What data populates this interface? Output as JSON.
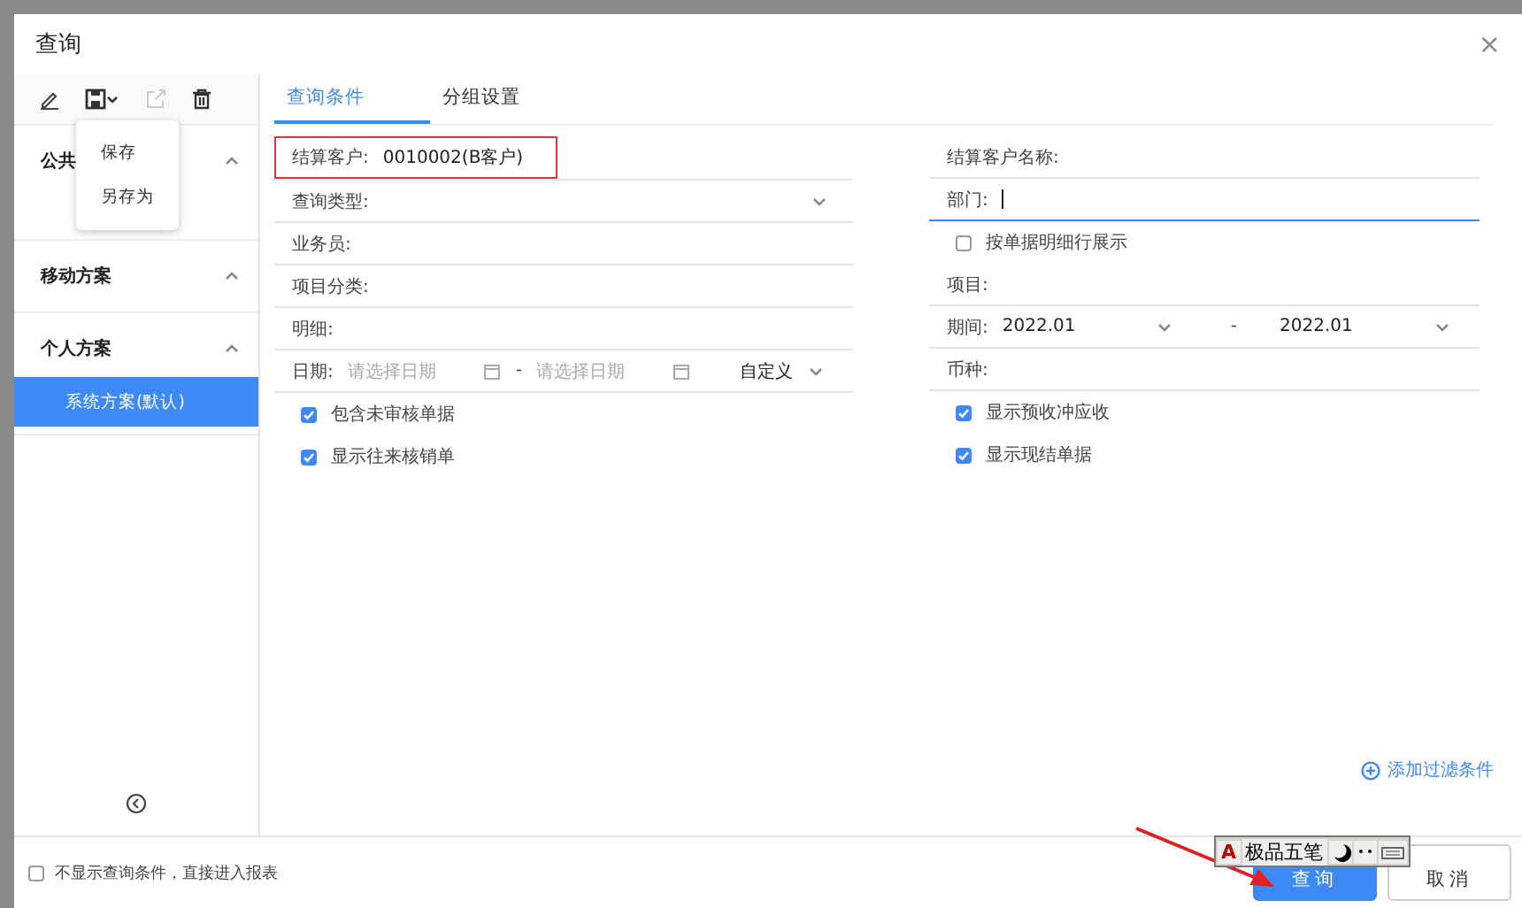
{
  "dialog": {
    "title": "查询",
    "close": "×"
  },
  "toolbar": {
    "save_menu": {
      "expanded": true,
      "items": [
        "保存",
        "另存为"
      ]
    }
  },
  "sidebar": {
    "groups": [
      {
        "title": "公共",
        "expanded": true
      },
      {
        "title": "移动方案",
        "expanded": true
      },
      {
        "title": "个人方案",
        "expanded": true,
        "items": [
          {
            "label": "系统方案(默认)",
            "selected": true
          }
        ]
      }
    ]
  },
  "tabs": [
    {
      "label": "查询条件",
      "selected": true
    },
    {
      "label": "分组设置",
      "selected": false
    }
  ],
  "form": {
    "left": [
      {
        "kind": "text",
        "label": "结算客户:",
        "value": "0010002(B客户)",
        "highlighted": true
      },
      {
        "kind": "select",
        "label": "查询类型:"
      },
      {
        "kind": "text",
        "label": "业务员:"
      },
      {
        "kind": "text",
        "label": "项目分类:"
      },
      {
        "kind": "text",
        "label": "明细:"
      },
      {
        "kind": "daterange",
        "label": "日期:",
        "from_placeholder": "请选择日期",
        "separator": "-",
        "to_placeholder": "请选择日期",
        "mode": "自定义"
      },
      {
        "kind": "checkbox",
        "label": "包含未审核单据",
        "checked": true
      },
      {
        "kind": "checkbox",
        "label": "显示往来核销单",
        "checked": true
      }
    ],
    "right": [
      {
        "kind": "text",
        "label": "结算客户名称:"
      },
      {
        "kind": "text",
        "label": "部门:",
        "focused": true
      },
      {
        "kind": "checkbox",
        "label": "按单据明细行展示",
        "checked": false
      },
      {
        "kind": "text",
        "label": "项目:"
      },
      {
        "kind": "period",
        "label": "期间:",
        "from": "2022.01",
        "separator": "-",
        "to": "2022.01"
      },
      {
        "kind": "text",
        "label": "币种:"
      },
      {
        "kind": "checkbox",
        "label": "显示预收冲应收",
        "checked": true
      },
      {
        "kind": "checkbox",
        "label": "显示现结单据",
        "checked": true
      }
    ]
  },
  "add_filter": "添加过滤条件",
  "footer": {
    "skip_checkbox": {
      "label": "不显示查询条件，直接进入报表",
      "checked": false
    },
    "buttons": [
      {
        "label": "查询",
        "kind": "primary"
      },
      {
        "label": "取消",
        "kind": "default"
      }
    ]
  },
  "ime_toolbar": {
    "mode": "A",
    "name": "极品五笔"
  }
}
